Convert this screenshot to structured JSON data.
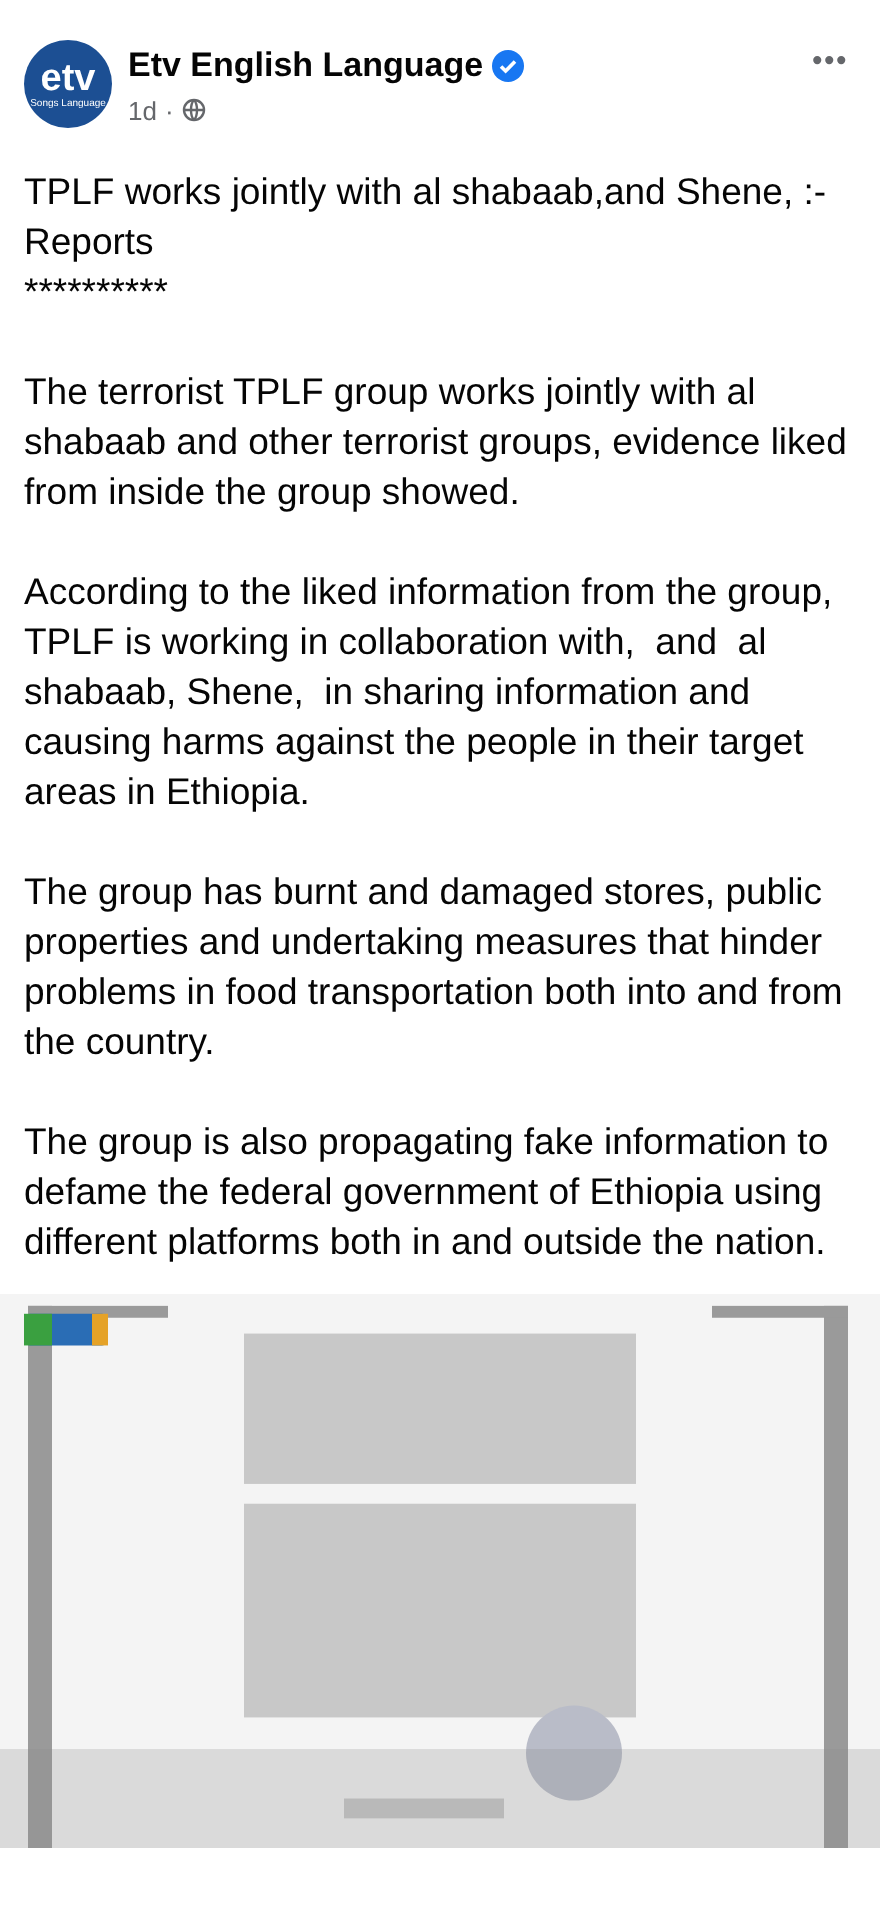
{
  "post": {
    "author": "Etv English Language",
    "verified": true,
    "avatar_text": "etv",
    "avatar_caption": "Songs Language",
    "time": "1d",
    "separator": "·",
    "menu": "•••",
    "paragraphs": [
      "TPLF works jointly with al shabaab,and Shene, :-Reports\n**********",
      "The terrorist TPLF group works jointly with al shabaab and other terrorist groups, evidence liked from inside the group showed.",
      "According to the liked information from the group, TPLF is working in collaboration with,  and  al shabaab, Shene,  in sharing information and causing harms against the people in their target areas in Ethiopia.",
      "The group has burnt and damaged stores, public properties and undertaking measures that hinder problems in food transportation both into and from the country.",
      "The group is also propagating fake information to defame the federal government of Ethiopia using different platforms both in and outside the nation."
    ]
  }
}
